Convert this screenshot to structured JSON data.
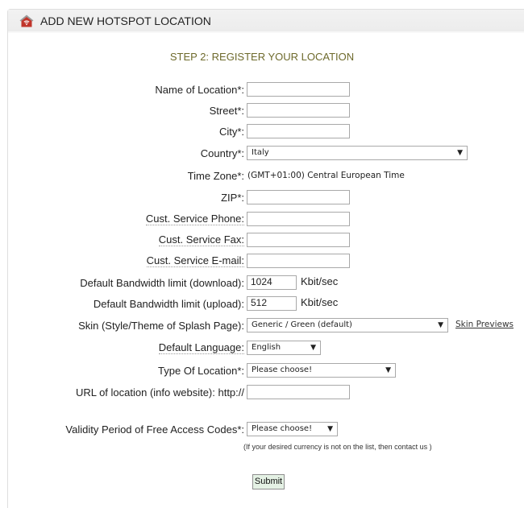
{
  "header": {
    "icon": "home-wifi-icon",
    "title": "ADD NEW HOTSPOT LOCATION"
  },
  "step_title": "STEP 2: REGISTER YOUR LOCATION",
  "form": {
    "name": {
      "label": "Name of Location*:",
      "value": ""
    },
    "street": {
      "label": "Street*:",
      "value": ""
    },
    "city": {
      "label": "City*:",
      "value": ""
    },
    "country": {
      "label": "Country*:",
      "selected": "Italy"
    },
    "timezone": {
      "label": "Time Zone*:",
      "value": "(GMT+01:00) Central European Time"
    },
    "zip": {
      "label": "ZIP*:",
      "value": ""
    },
    "phone": {
      "label": "Cust. Service Phone:",
      "value": ""
    },
    "fax": {
      "label": "Cust. Service Fax:",
      "value": ""
    },
    "email": {
      "label": "Cust. Service E-mail:",
      "value": ""
    },
    "bw_down": {
      "label": "Default Bandwidth limit (download):",
      "value": "1024",
      "unit": "Kbit/sec"
    },
    "bw_up": {
      "label": "Default Bandwidth limit (upload):",
      "value": "512",
      "unit": "Kbit/sec"
    },
    "skin": {
      "label": "Skin (Style/Theme of Splash Page):",
      "selected": "Generic / Green (default)",
      "link": "Skin Previews"
    },
    "language": {
      "label": "Default Language:",
      "selected": "English"
    },
    "type": {
      "label": "Type Of Location*:",
      "selected": "Please choose!"
    },
    "url": {
      "label": "URL of location (info website): http://",
      "value": ""
    },
    "validity": {
      "label": "Validity Period of Free Access Codes*:",
      "selected": "Please choose!"
    },
    "note": "(If your desired currency is not on the list, then contact us )",
    "submit_label": "Submit"
  }
}
